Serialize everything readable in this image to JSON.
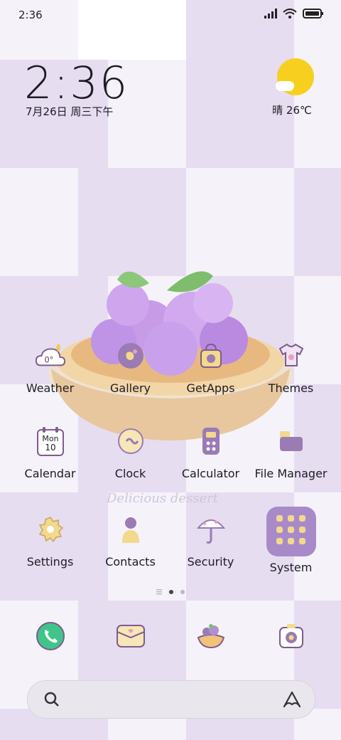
{
  "status_bar": {
    "time": "2:36",
    "icons": [
      "signal-icon",
      "wifi-icon",
      "battery-icon"
    ]
  },
  "clock_widget": {
    "time": "2:36",
    "date": "7月26日 周三下午"
  },
  "weather_widget": {
    "condition": "晴",
    "temperature": "晴 26℃",
    "icon": "sunny-cloud-icon"
  },
  "wallpaper": {
    "caption": "Delicious dessert",
    "colors": {
      "light": "#ffffff",
      "lavender": "#e6ddf0",
      "accent": "#a98ac8"
    }
  },
  "apps": [
    {
      "label": "Weather",
      "icon": "weather-icon"
    },
    {
      "label": "Gallery",
      "icon": "gallery-icon"
    },
    {
      "label": "GetApps",
      "icon": "getapps-icon"
    },
    {
      "label": "Themes",
      "icon": "themes-icon"
    },
    {
      "label": "Calendar",
      "icon": "calendar-icon",
      "day": "Mon",
      "date": "10"
    },
    {
      "label": "Clock",
      "icon": "clock-icon"
    },
    {
      "label": "Calculator",
      "icon": "calculator-icon"
    },
    {
      "label": "File Manager",
      "icon": "file-manager-icon"
    },
    {
      "label": "Settings",
      "icon": "settings-icon"
    },
    {
      "label": "Contacts",
      "icon": "contacts-icon"
    },
    {
      "label": "Security",
      "icon": "security-icon"
    },
    {
      "label": "System",
      "icon": "system-folder-icon"
    }
  ],
  "weather_icon_text": "0°",
  "page_indicator": {
    "pages": 2,
    "current": 1
  },
  "dock": [
    {
      "name": "phone",
      "icon": "phone-icon"
    },
    {
      "name": "messages",
      "icon": "messages-icon"
    },
    {
      "name": "browser",
      "icon": "browser-icon"
    },
    {
      "name": "camera",
      "icon": "camera-icon"
    }
  ],
  "search_bar": {
    "left_icon": "search-icon",
    "right_icon": "assistant-icon"
  }
}
